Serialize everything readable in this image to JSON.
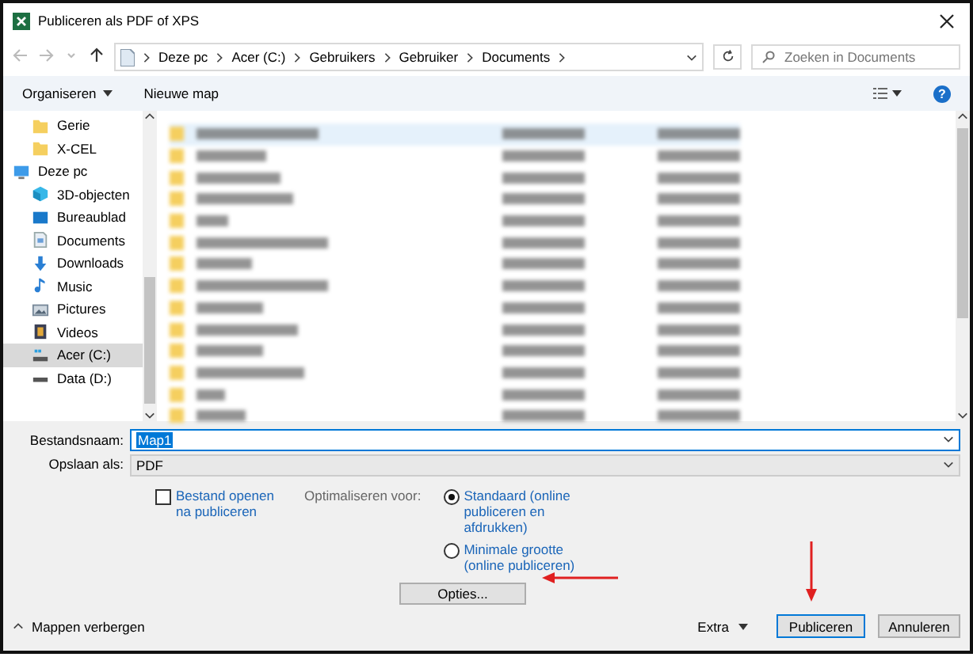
{
  "window": {
    "title": "Publiceren als PDF of XPS"
  },
  "address": {
    "segments": [
      "Deze pc",
      "Acer (C:)",
      "Gebruikers",
      "Gebruiker",
      "Documents"
    ],
    "search_placeholder": "Zoeken in Documents"
  },
  "toolbar": {
    "organize": "Organiseren",
    "new_folder": "Nieuwe map",
    "help": "?"
  },
  "sidebar": {
    "items": [
      {
        "label": "Gerie",
        "kind": "folder",
        "selected": false
      },
      {
        "label": "X-CEL",
        "kind": "folder",
        "selected": false
      },
      {
        "label": "Deze pc",
        "kind": "pc",
        "selected": false,
        "children": [
          {
            "label": "3D-objecten",
            "kind": "cube",
            "selected": false
          },
          {
            "label": "Bureaublad",
            "kind": "desktop",
            "selected": false
          },
          {
            "label": "Documents",
            "kind": "doc",
            "selected": false
          },
          {
            "label": "Downloads",
            "kind": "download",
            "selected": false
          },
          {
            "label": "Music",
            "kind": "music",
            "selected": false
          },
          {
            "label": "Pictures",
            "kind": "pictures",
            "selected": false
          },
          {
            "label": "Videos",
            "kind": "videos",
            "selected": false
          },
          {
            "label": "Acer (C:)",
            "kind": "os_drive",
            "selected": true
          },
          {
            "label": "Data (D:)",
            "kind": "drive",
            "selected": false
          }
        ]
      }
    ]
  },
  "form": {
    "filename_label": "Bestandsnaam:",
    "filename": "Map1",
    "type_label": "Opslaan als:",
    "type": "PDF",
    "open_after": {
      "label": "Bestand openen na publiceren",
      "checked": false
    },
    "optimize_label": "Optimaliseren voor:",
    "optimize_options": [
      {
        "label": "Standaard (online publiceren en afdrukken)",
        "selected": true
      },
      {
        "label": "Minimale grootte (online publiceren)",
        "selected": false
      }
    ],
    "options_button": "Opties..."
  },
  "footer": {
    "hide_folders": "Mappen verbergen",
    "extra": "Extra",
    "publish": "Publiceren",
    "cancel": "Annuleren"
  }
}
